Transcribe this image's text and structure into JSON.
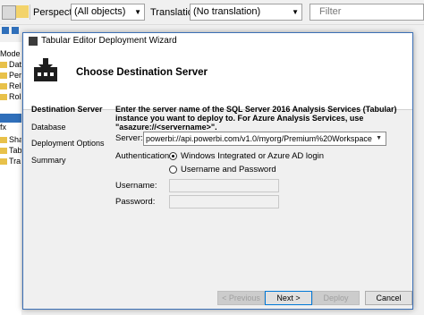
{
  "app": {
    "perspective_label": "Perspective:",
    "perspective_value": "(All objects)",
    "translation_label": "Translation:",
    "translation_value": "(No translation)",
    "filter_placeholder": "Filter",
    "tree_items": [
      "Mode",
      "Dat",
      "Per",
      "Rel",
      "Rol",
      "",
      "",
      "fx",
      "Sha",
      "Tab",
      "Tra"
    ]
  },
  "dialog": {
    "title": "Tabular Editor Deployment Wizard",
    "header_title": "Choose Destination Server",
    "nav": [
      "Destination Server",
      "Database",
      "Deployment Options",
      "Summary"
    ],
    "instructions": "Enter the server name of the SQL Server 2016 Analysis Services (Tabular) instance you want to deploy to. For Azure Analysis Services, use \"asazure://<servername>\".",
    "server_label": "Server:",
    "server_value": "powerbi://api.powerbi.com/v1.0/myorg/Premium%20Workspace",
    "auth_label": "Authentication:",
    "auth_options": [
      "Windows Integrated or Azure AD login",
      "Username and Password"
    ],
    "auth_selected": 0,
    "username_label": "Username:",
    "password_label": "Password:",
    "buttons": {
      "previous": "< Previous",
      "next": "Next >",
      "deploy": "Deploy",
      "cancel": "Cancel"
    }
  }
}
